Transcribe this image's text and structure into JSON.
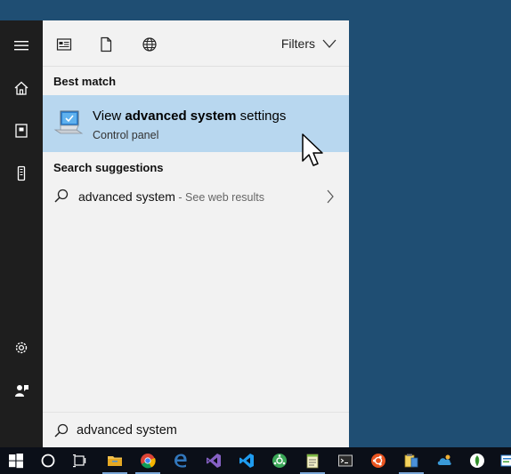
{
  "panel": {
    "filters_label": "Filters",
    "best_match_heading": "Best match",
    "suggestions_heading": "Search suggestions"
  },
  "best_match": {
    "title_prefix": "View ",
    "title_bold": "advanced system",
    "title_suffix": " settings",
    "subtitle": "Control panel"
  },
  "suggestion": {
    "query": "advanced system",
    "hint": " - See web results"
  },
  "search": {
    "value": "advanced system"
  },
  "rail": {
    "icons": [
      "hamburger-icon",
      "home-icon",
      "notebook-icon",
      "device-icon",
      "gear-icon",
      "feedback-icon"
    ]
  },
  "panel_tabs": [
    "apps-icon",
    "documents-icon",
    "web-icon"
  ],
  "taskbar": {
    "icons": [
      "windows-start-icon",
      "cortana-icon",
      "task-view-icon",
      "file-explorer-icon",
      "chrome-icon",
      "edge-icon",
      "visual-studio-icon",
      "vscode-icon",
      "app-green-icon",
      "notepad-icon",
      "terminal-icon",
      "ubuntu-icon",
      "app-tools-icon",
      "app-cloud-icon",
      "app-leaf-icon",
      "app-edge-icon"
    ]
  },
  "colors": {
    "desktop": "#1f4e73",
    "rail": "#1e1e1e",
    "panel": "#f2f2f2",
    "selected": "#b8d7ef",
    "taskbar": "#0b0f18"
  }
}
